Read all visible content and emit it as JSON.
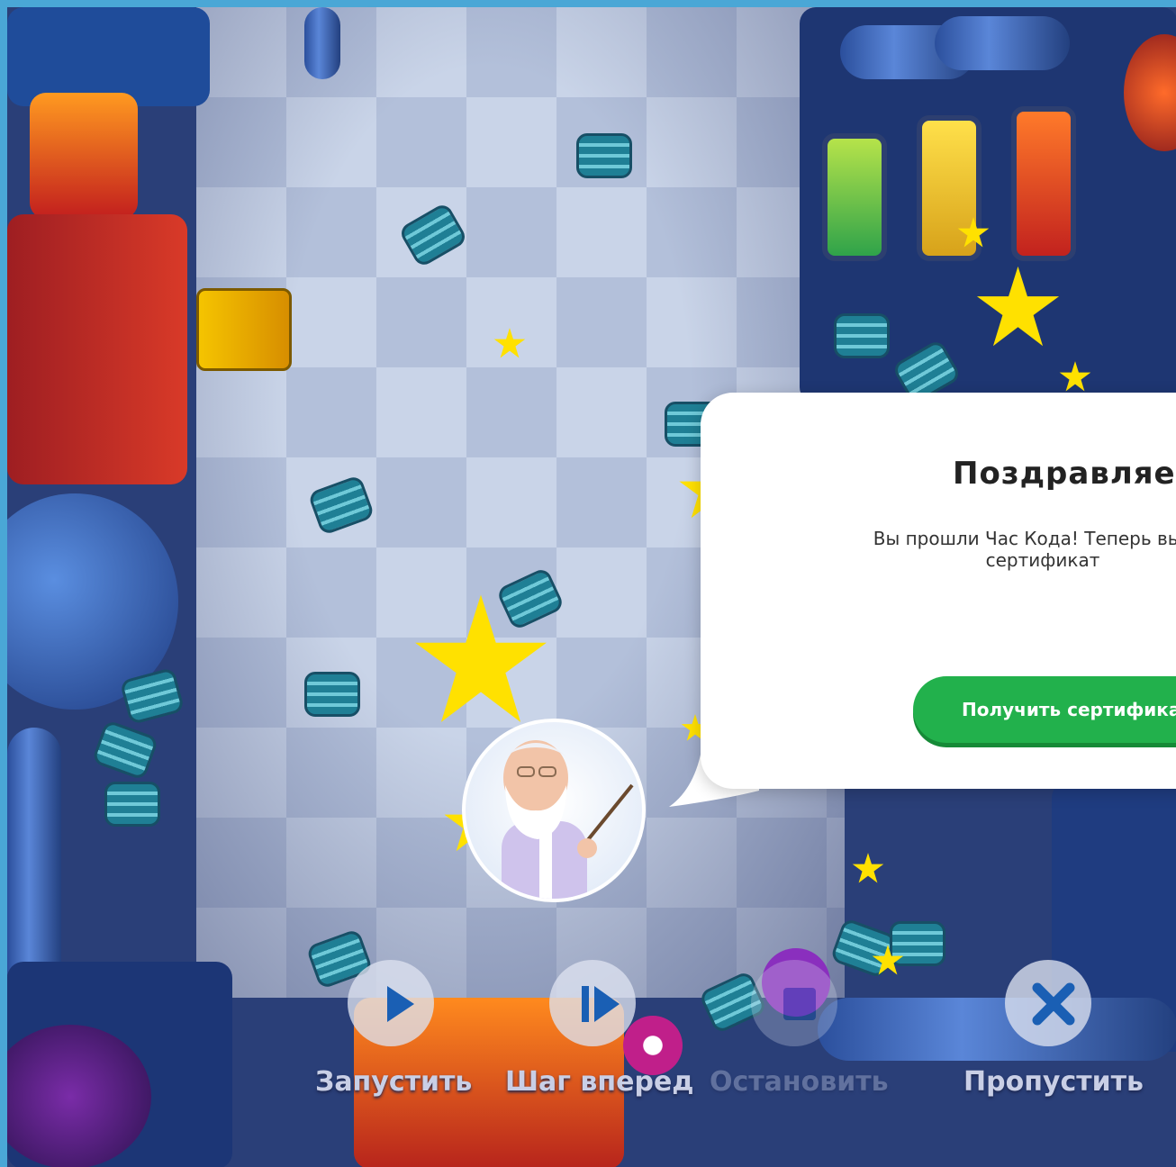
{
  "dialog": {
    "title": "Поздравляем!",
    "message_line1": "Вы прошли Час Кода! Теперь вы мо",
    "message_line2": "сертификат",
    "button_label": "Получить сертификат"
  },
  "controls": {
    "run_label": "Запустить",
    "step_label": "Шаг вперед",
    "stop_label": "Остановить",
    "skip_label": "Пропустить"
  },
  "colors": {
    "accent_green": "#22b14c",
    "control_icon_blue": "#1a5fb4",
    "star_yellow": "#ffe100"
  }
}
